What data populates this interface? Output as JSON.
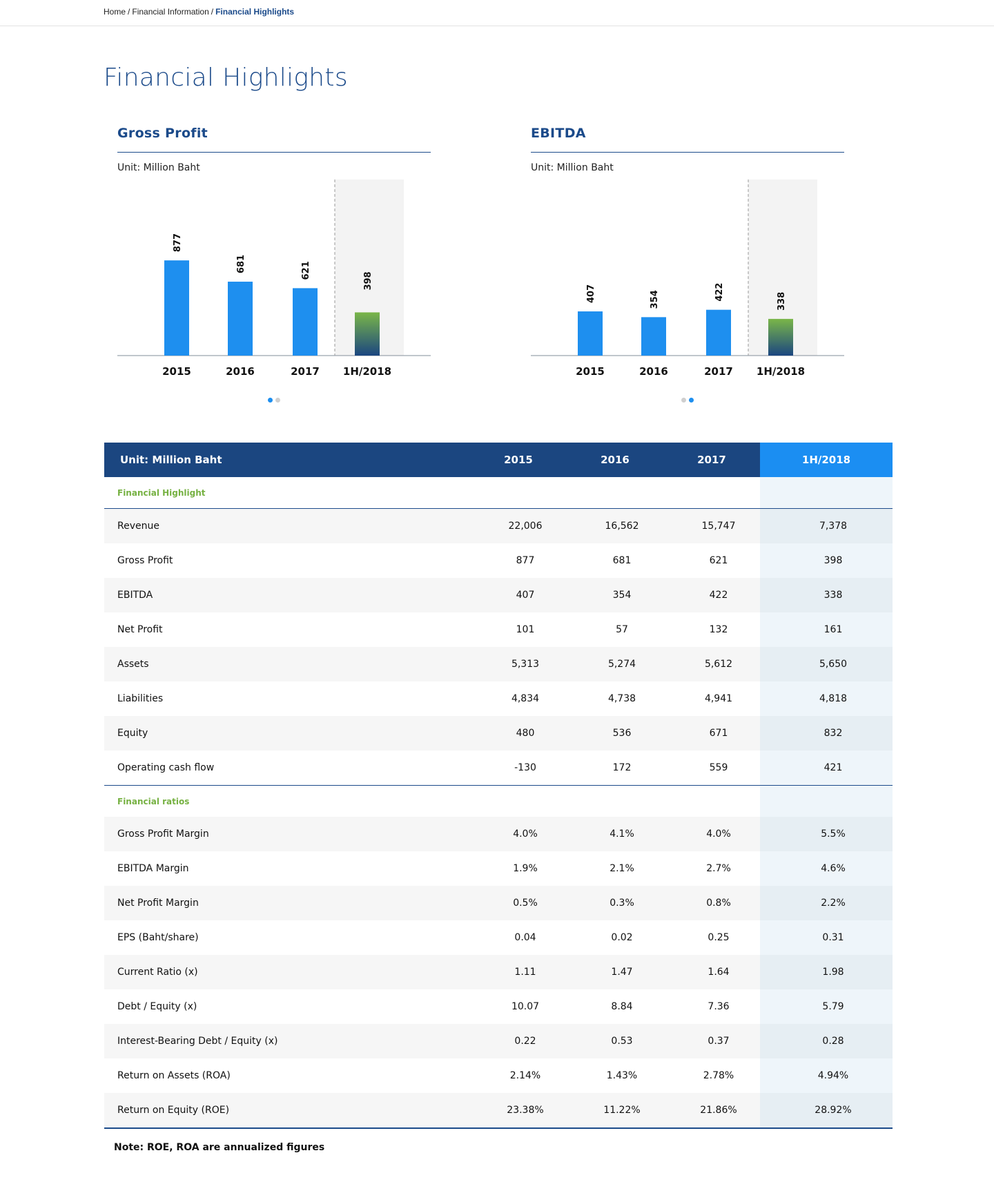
{
  "breadcrumb": {
    "items": [
      "Home",
      "Financial Information"
    ],
    "separator": "/",
    "current": "Financial Highlights"
  },
  "page": {
    "title": "Financial Highlights"
  },
  "charts": [
    {
      "title": "Gross Profit",
      "unit": "Unit: Million Baht",
      "active_dot": 0
    },
    {
      "title": "EBITDA",
      "unit": "Unit: Million Baht",
      "active_dot": 1
    }
  ],
  "chart_data": [
    {
      "type": "bar",
      "title": "Gross Profit",
      "subtitle": "Unit: Million Baht",
      "categories": [
        "2015",
        "2016",
        "2017",
        "1H/2018"
      ],
      "values": [
        877,
        681,
        621,
        398
      ],
      "highlight_category": "1H/2018",
      "colors": {
        "bar": "#1e8fef",
        "highlight_top": "#7ab648",
        "highlight_bottom": "#1b4680",
        "highlight_bg": "#f3f3f3"
      }
    },
    {
      "type": "bar",
      "title": "EBITDA",
      "subtitle": "Unit: Million Baht",
      "categories": [
        "2015",
        "2016",
        "2017",
        "1H/2018"
      ],
      "values": [
        407,
        354,
        422,
        338
      ],
      "highlight_category": "1H/2018",
      "colors": {
        "bar": "#1e8fef",
        "highlight_top": "#7ab648",
        "highlight_bottom": "#1b4680",
        "highlight_bg": "#f3f3f3"
      }
    }
  ],
  "table": {
    "header": [
      "Unit: Million Baht",
      "2015",
      "2016",
      "2017",
      "1H/2018"
    ],
    "sections": [
      {
        "title": "Financial Highlight",
        "rows": [
          {
            "label": "Revenue",
            "values": [
              "22,006",
              "16,562",
              "15,747",
              "7,378"
            ]
          },
          {
            "label": "Gross Profit",
            "values": [
              "877",
              "681",
              "621",
              "398"
            ]
          },
          {
            "label": "EBITDA",
            "values": [
              "407",
              "354",
              "422",
              "338"
            ]
          },
          {
            "label": "Net Profit",
            "values": [
              "101",
              "57",
              "132",
              "161"
            ]
          },
          {
            "label": "Assets",
            "values": [
              "5,313",
              "5,274",
              "5,612",
              "5,650"
            ]
          },
          {
            "label": "Liabilities",
            "values": [
              "4,834",
              "4,738",
              "4,941",
              "4,818"
            ]
          },
          {
            "label": "Equity",
            "values": [
              "480",
              "536",
              "671",
              "832"
            ]
          },
          {
            "label": "Operating cash flow",
            "values": [
              "-130",
              "172",
              "559",
              "421"
            ]
          }
        ]
      },
      {
        "title": "Financial ratios",
        "rows": [
          {
            "label": "Gross Profit Margin",
            "values": [
              "4.0%",
              "4.1%",
              "4.0%",
              "5.5%"
            ]
          },
          {
            "label": "EBITDA Margin",
            "values": [
              "1.9%",
              "2.1%",
              "2.7%",
              "4.6%"
            ]
          },
          {
            "label": "Net Profit Margin",
            "values": [
              "0.5%",
              "0.3%",
              "0.8%",
              "2.2%"
            ]
          },
          {
            "label": "EPS (Baht/share)",
            "values": [
              "0.04",
              "0.02",
              "0.25",
              "0.31"
            ]
          },
          {
            "label": "Current Ratio (x)",
            "values": [
              "1.11",
              "1.47",
              "1.64",
              "1.98"
            ]
          },
          {
            "label": "Debt / Equity (x)",
            "values": [
              "10.07",
              "8.84",
              "7.36",
              "5.79"
            ]
          },
          {
            "label": "Interest-Bearing Debt / Equity (x)",
            "values": [
              "0.22",
              "0.53",
              "0.37",
              "0.28"
            ]
          },
          {
            "label": "Return on Assets (ROA)",
            "values": [
              "2.14%",
              "1.43%",
              "2.78%",
              "4.94%"
            ]
          },
          {
            "label": "Return on Equity (ROE)",
            "values": [
              "23.38%",
              "11.22%",
              "21.86%",
              "28.92%"
            ]
          }
        ]
      }
    ]
  },
  "note": "Note: ROE, ROA are annualized figures"
}
